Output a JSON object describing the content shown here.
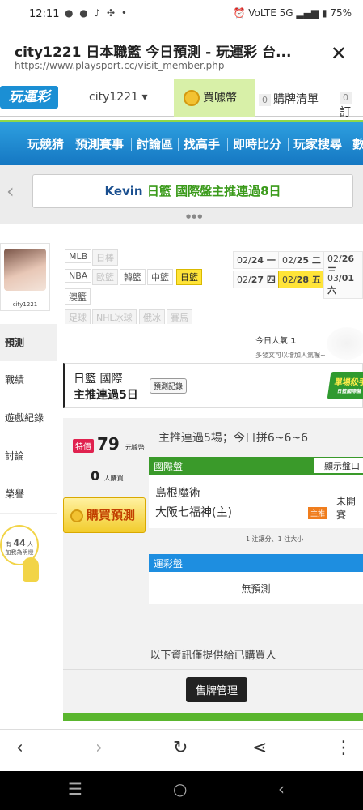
{
  "status": {
    "time": "12:11",
    "left_icons": "● ● ♪ ✣ •",
    "right_icons": "⏰ VoLTE 5G ▂▄▆ ▮ 75%"
  },
  "browser": {
    "title": "city1221 日本職籃 今日預測 - 玩運彩 台...",
    "url": "https://www.playsport.cc/visit_member.php",
    "close_icon": "close-icon"
  },
  "topnav": {
    "logo": "玩運彩",
    "user": "city1221 ▾",
    "buy_coins": "買噱幣",
    "buy_list_count": "0",
    "buy_list": "購牌清單",
    "sub_count": "0",
    "sub_label": "訂"
  },
  "mainnav": [
    "玩競猜",
    "預測賽事",
    "討論區",
    "找高手",
    "即時比分",
    "玩家搜尋",
    "數"
  ],
  "banner": {
    "name": "Kevin",
    "league": "日籃",
    "text": "國際盤主推連過8日"
  },
  "profile": {
    "username": "city1221"
  },
  "leagues": [
    {
      "label": "MLB",
      "state": "normal"
    },
    {
      "label": "日棒",
      "state": "dim"
    },
    {
      "label": "NBA",
      "state": "normal"
    },
    {
      "label": "歐籃",
      "state": "dim"
    },
    {
      "label": "韓籃",
      "state": "normal"
    },
    {
      "label": "中籃",
      "state": "normal"
    },
    {
      "label": "日籃",
      "state": "selected"
    },
    {
      "label": "澳籃",
      "state": "normal"
    },
    {
      "label": "足球",
      "state": "dim"
    },
    {
      "label": "NHL冰球",
      "state": "dim"
    },
    {
      "label": "俄冰",
      "state": "dim"
    },
    {
      "label": "賽馬",
      "state": "dim"
    }
  ],
  "dates": [
    {
      "date": "02/",
      "day": "24 一",
      "state": "normal"
    },
    {
      "date": "02/",
      "day": "25 二",
      "state": "normal"
    },
    {
      "date": "02/",
      "day": "26 三",
      "state": "normal"
    },
    {
      "date": "02/",
      "day": "27 四",
      "state": "normal"
    },
    {
      "date": "02/",
      "day": "28 五",
      "state": "selected"
    },
    {
      "date": "03/",
      "day": "01 六",
      "state": "normal"
    }
  ],
  "sidebar": {
    "items": [
      "預測",
      "戰績",
      "遊戲紀錄",
      "討論",
      "榮譽"
    ],
    "fans_prefix": "有",
    "fans_count": "44",
    "fans_suffix": "人",
    "fans_note": "加我為明燈"
  },
  "popularity": {
    "label": "今日人氣",
    "value": "1",
    "note": "多發文可以增加人氣喔~"
  },
  "titlecard": {
    "line1": "日籃 國際",
    "line2": "主推連過5日",
    "record_btn": "預測記錄",
    "killer": "單場殺手",
    "killer_sub": "日籃國際盤"
  },
  "pricing": {
    "special": "特價",
    "price": "79",
    "unit": "元噱幣",
    "buyers": "0",
    "buyers_unit": "人購買",
    "buy_btn": "購買預測"
  },
  "streak": "主推連過5場；今日拼6~6~6",
  "intl": {
    "header": "國際盤",
    "show_odds": "顯示盤口",
    "team_away": "島根魔術",
    "team_home": "大阪七福神(主)",
    "home_tag": "主推",
    "result": "未開賽",
    "note": "1 注讓分、1 注大小"
  },
  "lottery": {
    "header": "運彩盤",
    "value": "無預測"
  },
  "buyonly": "以下資訊僅提供給已購買人",
  "sell_mgr": "售牌管理",
  "browser_bottom": [
    "‹",
    "›",
    "↻",
    "⋖",
    "⋮"
  ],
  "sysnav": [
    "☰",
    "○",
    "‹"
  ]
}
